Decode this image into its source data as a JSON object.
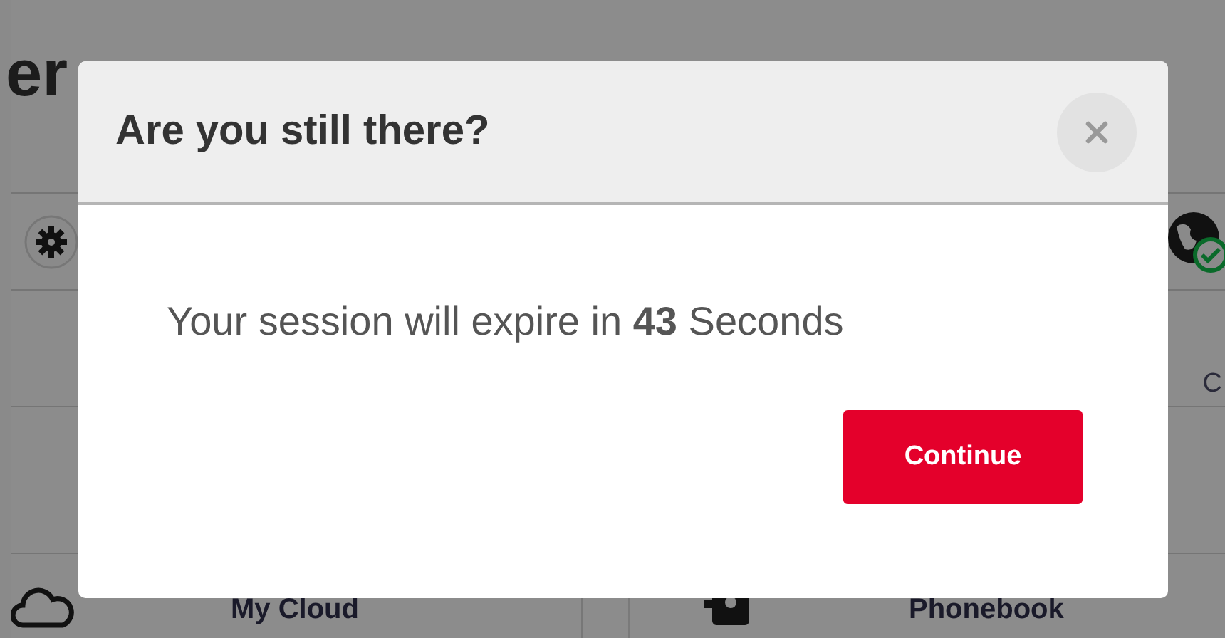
{
  "background": {
    "heading": "er",
    "side_label": "C",
    "tiles": [
      {
        "label": "My Cloud"
      },
      {
        "label": "Phonebook"
      }
    ]
  },
  "dialog": {
    "title": "Are you still there?",
    "message": "Your session will expire in **43** Seconds",
    "button": "Continue"
  }
}
